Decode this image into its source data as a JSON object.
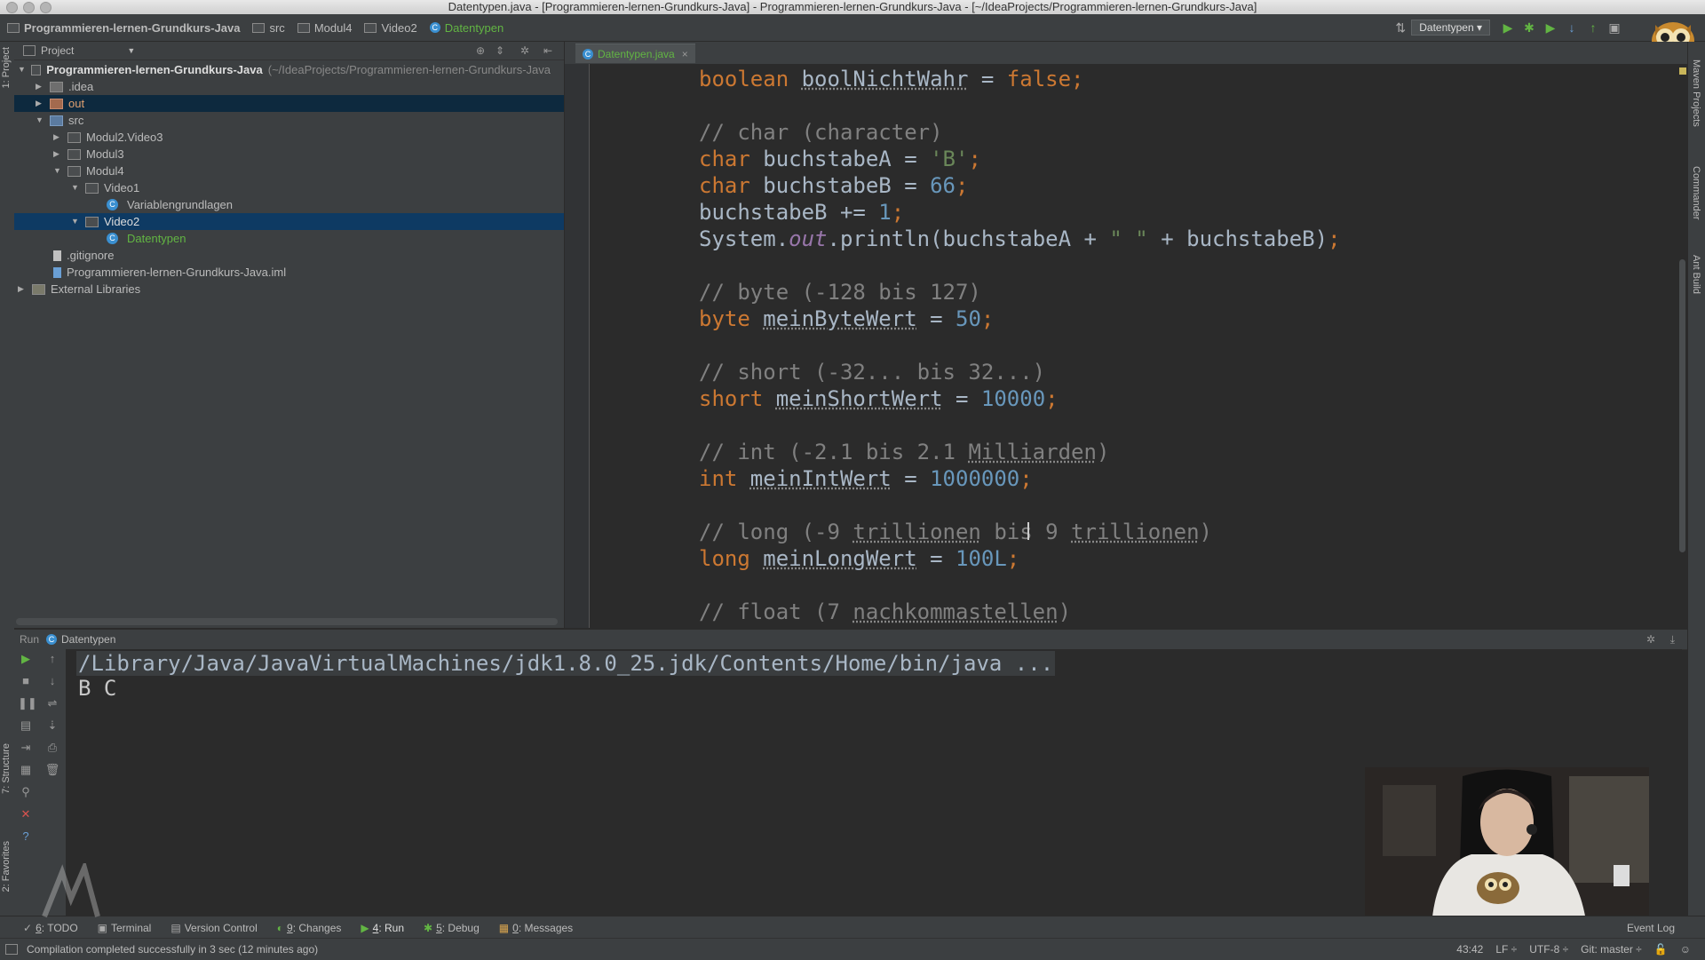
{
  "window": {
    "title": "Datentypen.java - [Programmieren-lernen-Grundkurs-Java] - Programmieren-lernen-Grundkurs-Java - [~/IdeaProjects/Programmieren-lernen-Grundkurs-Java]"
  },
  "breadcrumbs": [
    "Programmieren-lernen-Grundkurs-Java",
    "src",
    "Modul4",
    "Video2",
    "Datentypen"
  ],
  "toolbar": {
    "run_config": "Datentypen"
  },
  "project_panel": {
    "title": "Project",
    "root_name": "Programmieren-lernen-Grundkurs-Java",
    "root_path": "(~/IdeaProjects/Programmieren-lernen-Grundkurs-Java",
    "tree": [
      {
        "label": ".idea"
      },
      {
        "label": "out"
      },
      {
        "label": "src"
      },
      {
        "label": "Modul2.Video3"
      },
      {
        "label": "Modul3"
      },
      {
        "label": "Modul4"
      },
      {
        "label": "Video1"
      },
      {
        "label": "Variablengrundlagen"
      },
      {
        "label": "Video2"
      },
      {
        "label": "Datentypen"
      },
      {
        "label": ".gitignore"
      },
      {
        "label": "Programmieren-lernen-Grundkurs-Java.iml"
      },
      {
        "label": "External Libraries"
      }
    ]
  },
  "editor": {
    "tab_label": "Datentypen.java",
    "lines": [
      {
        "kw": "boolean ",
        "name": "boolNichtWahr",
        "rest": " = ",
        "val": "false",
        "valtype": "kw",
        "end": ";"
      },
      {
        "comment": "// char (character)"
      },
      {
        "kw": "char ",
        "name": "buchstabeA",
        "rest": " = ",
        "val": "'B'",
        "valtype": "str",
        "end": ";"
      },
      {
        "kw": "char ",
        "name": "buchstabeB",
        "rest": " = ",
        "val": "66",
        "valtype": "num",
        "end": ";"
      },
      {
        "plain": "buchstabeB += ",
        "val": "1",
        "valtype": "num",
        "end": ";"
      },
      {
        "p1": "System.",
        "fld": "out",
        "p2": ".println(buchstabeA + ",
        "s": "\" \"",
        "p3": " + buchstabeB)",
        "end": ";"
      },
      {
        "comment": "// byte (-128 bis 127)"
      },
      {
        "kw": "byte ",
        "name": "meinByteWert",
        "rest": " = ",
        "val": "50",
        "valtype": "num",
        "end": ";"
      },
      {
        "comment": "// short (-32... bis 32...)"
      },
      {
        "kw": "short ",
        "name": "meinShortWert",
        "rest": " = ",
        "val": "10000",
        "valtype": "num",
        "end": ";"
      },
      {
        "comment_a": "// int (-2.1 bis 2.1 ",
        "comment_u": "Milliarden",
        "comment_b": ")"
      },
      {
        "kw": "int ",
        "name": "meinIntWert",
        "rest": " = ",
        "val": "1000000",
        "valtype": "num",
        "end": ";"
      },
      {
        "comment_a": "// long (-9 ",
        "comment_u": "trillionen",
        "comment_m": " bis 9 ",
        "comment_u2": "trillionen",
        "comment_b": ")"
      },
      {
        "kw": "long ",
        "name": "meinLongWert",
        "rest": " = ",
        "val": "100L",
        "valtype": "num",
        "end": ";"
      },
      {
        "comment_a": "// float (7 ",
        "comment_u": "nachkommastellen",
        "comment_b": ")"
      }
    ]
  },
  "run_panel": {
    "label": "Run",
    "config": "Datentypen",
    "console_lines": [
      "/Library/Java/JavaVirtualMachines/jdk1.8.0_25.jdk/Contents/Home/bin/java ...",
      "B C"
    ]
  },
  "left_strip": {
    "project": "1: Project",
    "structure": "7: Structure",
    "favorites": "2: Favorites"
  },
  "right_strip": {
    "maven": "Maven Projects",
    "commander": "Commander",
    "ant": "Ant Build"
  },
  "bottom_tabs": [
    {
      "num": "6",
      "label": ": TODO"
    },
    {
      "num": "",
      "label": "Terminal"
    },
    {
      "num": "",
      "label": "Version Control"
    },
    {
      "num": "9",
      "label": ": Changes"
    },
    {
      "num": "4",
      "label": ": Run"
    },
    {
      "num": "5",
      "label": ": Debug"
    },
    {
      "num": "0",
      "label": ": Messages"
    }
  ],
  "event_log": "Event Log",
  "status": {
    "message": "Compilation completed successfully in 3 sec (12 minutes ago)",
    "position": "43:42",
    "line_sep": "LF ÷",
    "encoding": "UTF-8 ÷",
    "git": "Git: master ÷"
  },
  "colors": {
    "keyword": "#cc7832",
    "comment": "#808080",
    "number": "#6897bb",
    "string": "#6a8759",
    "field": "#9876aa",
    "selection": "#0e3a63",
    "accent_green": "#62b543"
  }
}
